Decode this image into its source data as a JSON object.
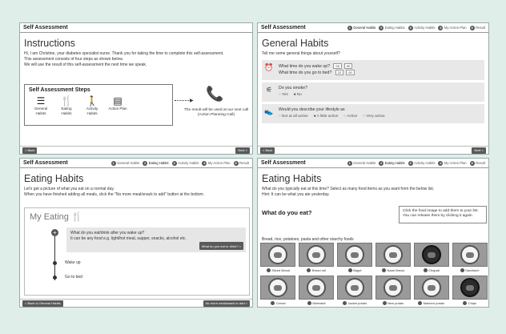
{
  "step_names": [
    "General Habits",
    "Eating Habits",
    "Activity Habits",
    "My Action Plan",
    "Result"
  ],
  "p1": {
    "header": "Self Assessment",
    "title": "Instructions",
    "paragraphs": [
      "Hi, I am Christine, your diabetes specialist nurse. Thank you for taking the time to complete this self-assessment.",
      "This assessment consists of four steps as shown below.",
      "We will use the result of this self-assessment the next time we speak."
    ],
    "steps_title": "Self Assessment Steps",
    "steps": [
      {
        "icon": "clipboard-icon",
        "glyph": "☰",
        "label": "General Habits"
      },
      {
        "icon": "fork-knife-icon",
        "glyph": "🍴",
        "label": "Eating Habits"
      },
      {
        "icon": "walking-icon",
        "glyph": "🚶",
        "label": "Activity Habits"
      },
      {
        "icon": "list-icon",
        "glyph": "▤",
        "label": "Action Plan"
      }
    ],
    "call_text": "The result will be used at our next call (Action Planning Call)",
    "back": "Back",
    "next": "Next"
  },
  "p2": {
    "header": "Self Assessment",
    "title": "General Habits",
    "intro": "Tell me some general things about yourself?",
    "wake_q": "What time do you wake up?",
    "bed_q": "What time do you go to bed?",
    "wake_h": "00",
    "wake_m": "00",
    "bed_h": "22",
    "bed_m": "00",
    "smoke_q": "Do you smoke?",
    "smoke_opts": [
      "Yes",
      "No"
    ],
    "smoke_sel": "No",
    "life_q": "Would you describe your lifestyle as",
    "life_opts": [
      "Not at all active",
      "A little active",
      "Active",
      "Very active"
    ],
    "life_sel": "A little active",
    "back": "Back",
    "next": "Next"
  },
  "p3": {
    "header": "Self Assessment",
    "title": "Eating Habits",
    "intro1": "Let's get a picture of what you eat on a normal day.",
    "intro2": "When you have finished adding all meals, click the \"No more meal/snack to add\" button at the bottom.",
    "my_eating": "My Eating",
    "ask1": "What do you eat/drink after you wake up?",
    "ask2": "It can be any food e.g. light/hot meal, supper, snacks, alcohol etc.",
    "ask_btn": "What do you eat or drink?",
    "wake": "Wake up",
    "bed": "Go to bed",
    "back": "Back to General Habits",
    "next": "No more meal/snack to add"
  },
  "p4": {
    "header": "Self Assessment",
    "title": "Eating Habits",
    "intro1": "What do you typically eat at this time? Select as many food items as you want from the below list.",
    "intro2": "Hint: It can be what you ate yesterday.",
    "question": "What do you eat?",
    "tip1": "Click the food image to add them to your list.",
    "tip2": "You can release them by clicking it again.",
    "category": "Bread, rice, potatoes, pasta and other starchy foods",
    "foods": [
      {
        "name": "Sliced Bread",
        "dark": false
      },
      {
        "name": "Bread roll",
        "dark": false
      },
      {
        "name": "Bagel",
        "dark": false
      },
      {
        "name": "Naan Bread",
        "dark": false
      },
      {
        "name": "Chapati",
        "dark": true
      },
      {
        "name": "Sandwich",
        "dark": false
      },
      {
        "name": "Cereal",
        "dark": false
      },
      {
        "name": "Weetabix",
        "dark": false
      },
      {
        "name": "Jacket potato",
        "dark": false
      },
      {
        "name": "New potato",
        "dark": false
      },
      {
        "name": "Mashed potato",
        "dark": false
      },
      {
        "name": "Chips",
        "dark": true
      }
    ]
  }
}
